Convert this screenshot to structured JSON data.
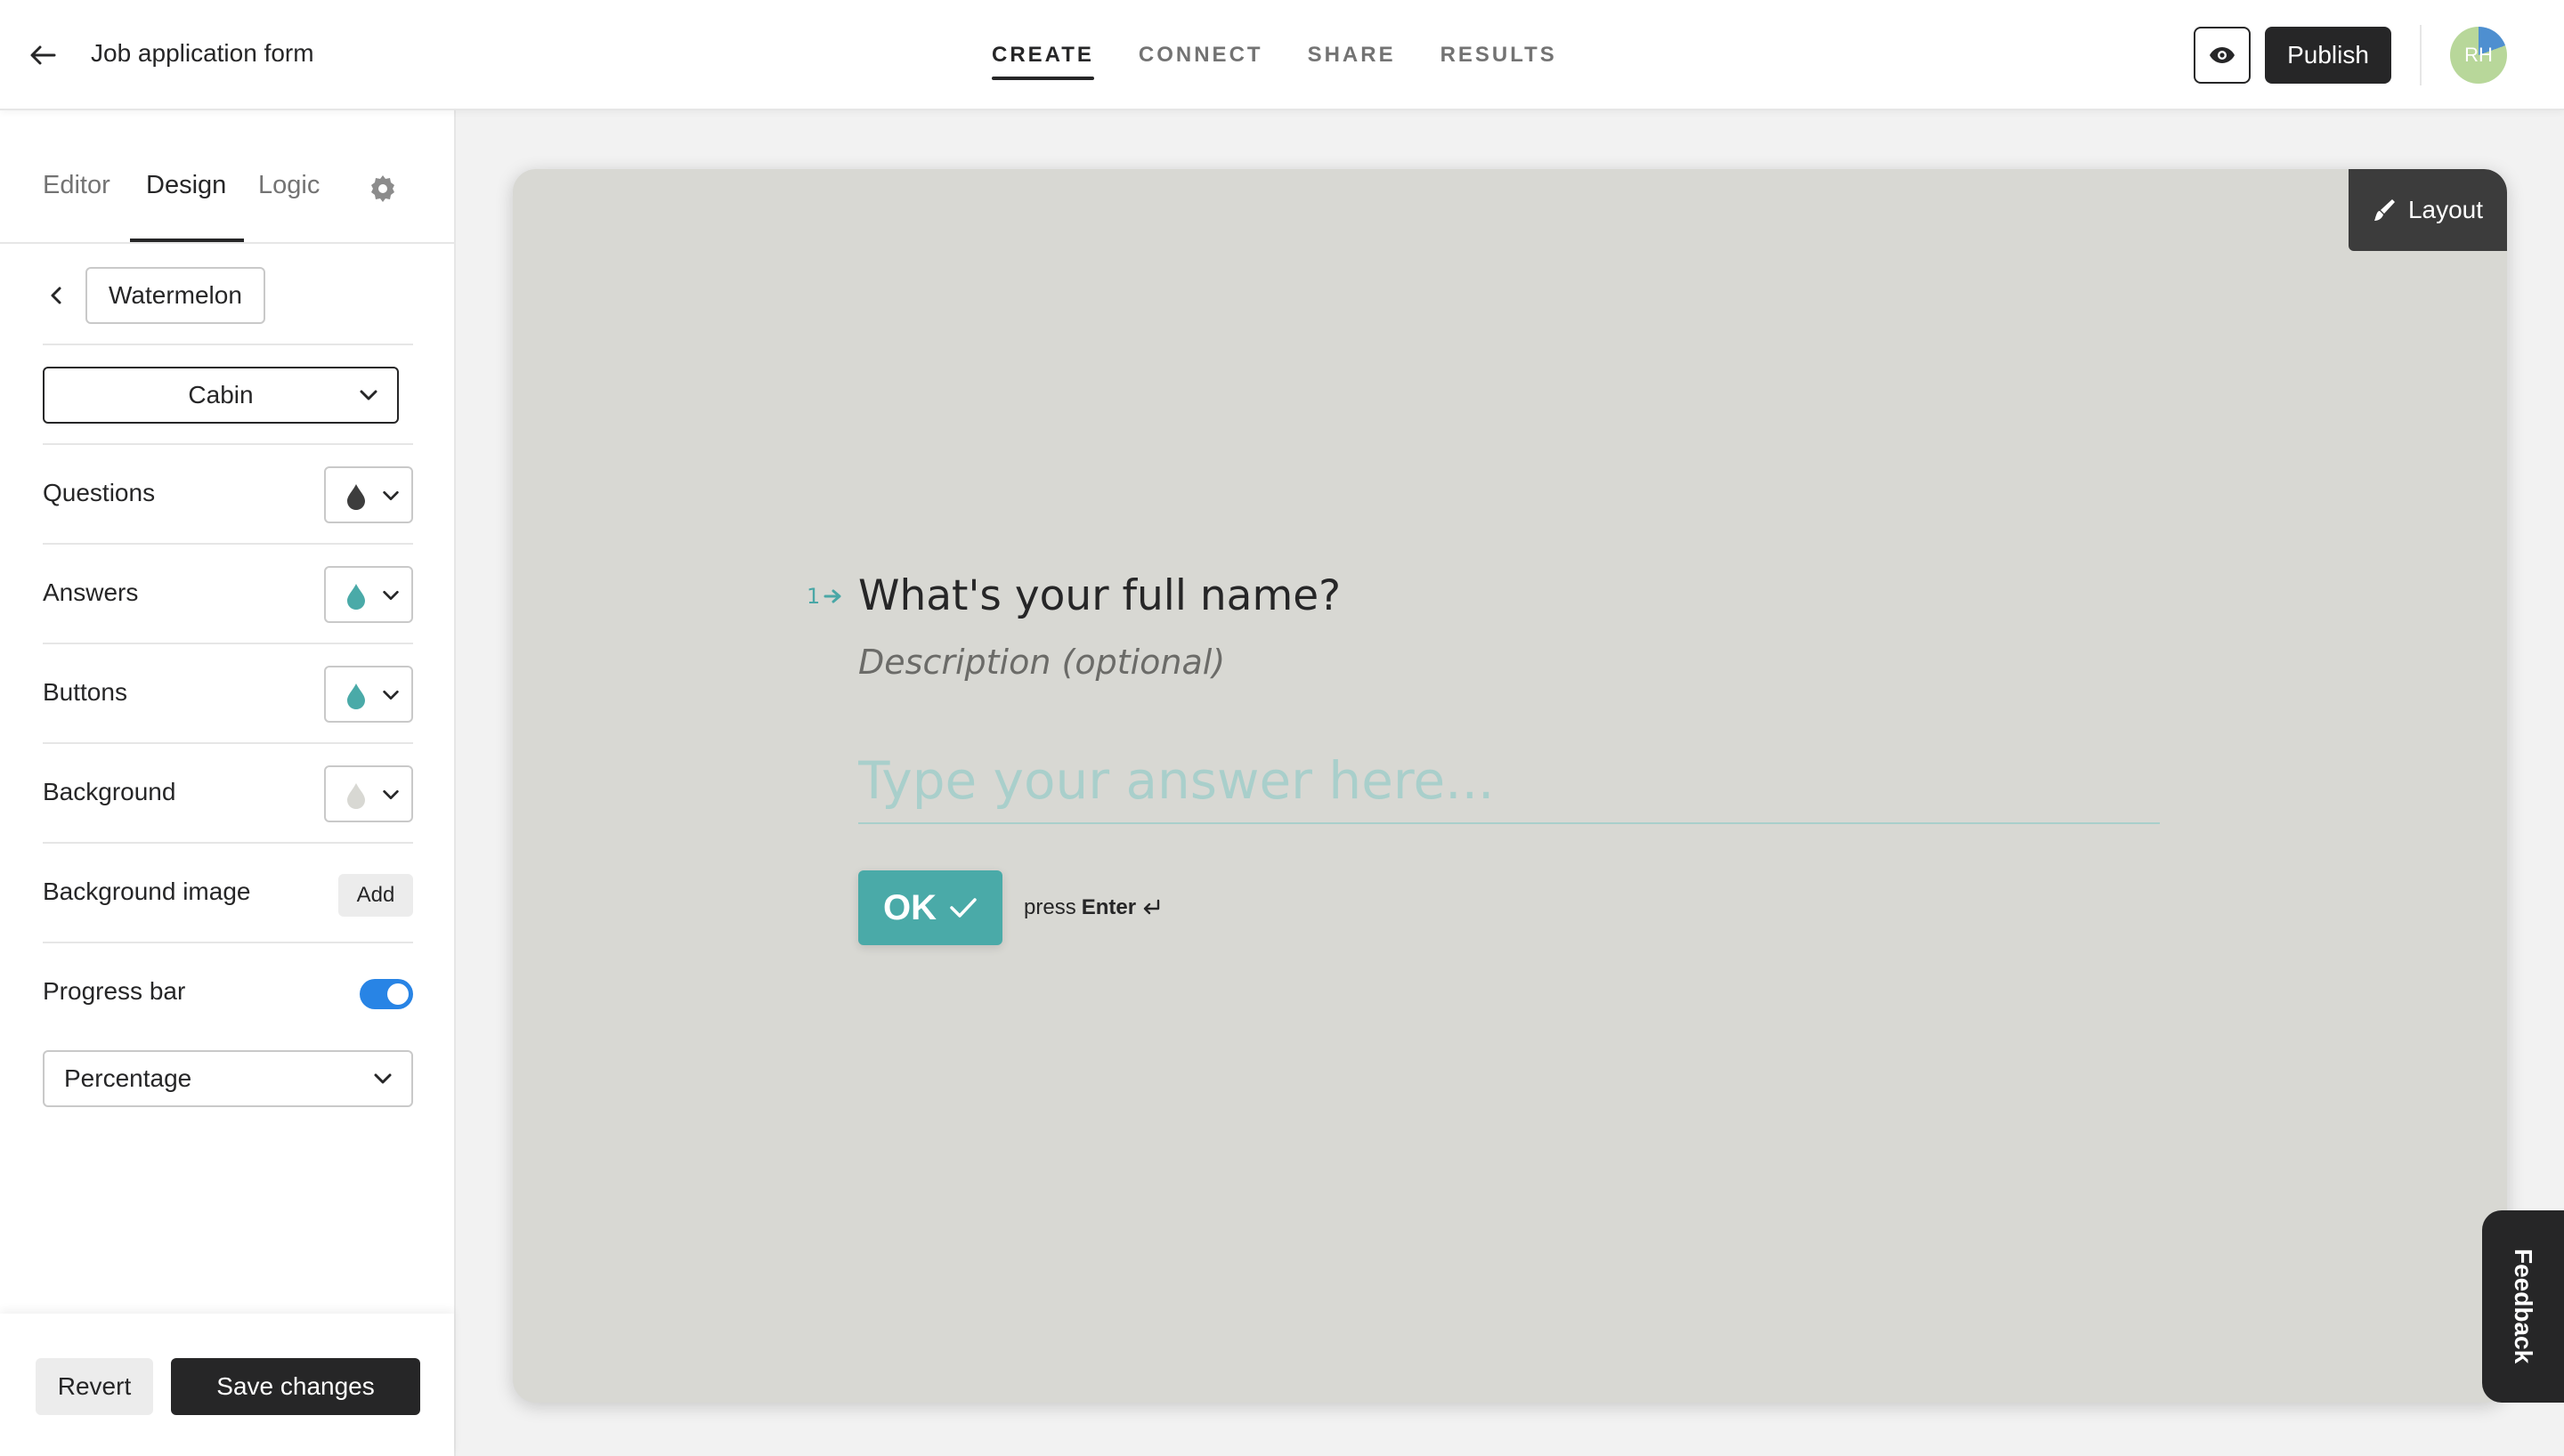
{
  "header": {
    "form_title": "Job application form",
    "tabs": [
      {
        "label": "CREATE",
        "active": true
      },
      {
        "label": "CONNECT",
        "active": false
      },
      {
        "label": "SHARE",
        "active": false
      },
      {
        "label": "RESULTS",
        "active": false
      }
    ],
    "publish_label": "Publish",
    "avatar_initials": "RH"
  },
  "panel": {
    "tabs": [
      {
        "label": "Editor",
        "active": false
      },
      {
        "label": "Design",
        "active": true
      },
      {
        "label": "Logic",
        "active": false
      }
    ],
    "theme_name": "Watermelon",
    "font": "Cabin",
    "settings": [
      {
        "label": "Questions",
        "color": "#3d3d3d"
      },
      {
        "label": "Answers",
        "color": "#4aaaa8"
      },
      {
        "label": "Buttons",
        "color": "#4aaaa8"
      },
      {
        "label": "Background",
        "color": "#d8d8d3"
      }
    ],
    "background_image_label": "Background image",
    "add_label": "Add",
    "progress_bar_label": "Progress bar",
    "progress_bar_enabled": true,
    "progress_type": "Percentage",
    "revert_label": "Revert",
    "save_label": "Save changes"
  },
  "canvas": {
    "layout_label": "Layout",
    "question_number": "1",
    "question_title": "What's your full name?",
    "description": "Description (optional)",
    "answer_placeholder": "Type your answer here...",
    "ok_label": "OK",
    "press_label": "press",
    "enter_label": "Enter"
  },
  "feedback_label": "Feedback",
  "colors": {
    "accent": "#4aaaa8",
    "toggle": "#2884e5",
    "dark": "#262627",
    "canvas_bg": "#d8d8d3"
  }
}
